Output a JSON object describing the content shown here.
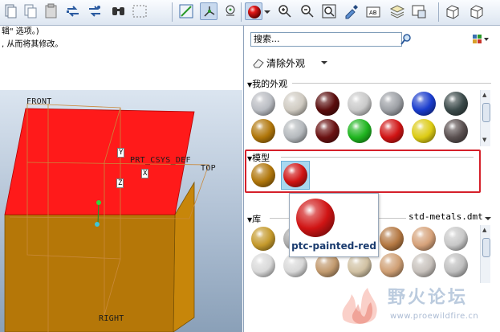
{
  "toolbar": {
    "icons": [
      "cut-icon",
      "copy-icon",
      "paste-icon",
      "regenerate-icon",
      "regenerate-manager-icon",
      "find-icon",
      "select-box-icon",
      "datum-display-icon",
      "csys-display-icon",
      "spin-center-icon",
      "appearance-gallery-icon",
      "dropdown-arrow-icon",
      "zoom-in-icon",
      "zoom-out-icon",
      "refit-icon",
      "repaint-icon",
      "annotation-icon",
      "layers-icon",
      "view-manager-icon",
      "saved-view-icon",
      "orient-icon"
    ]
  },
  "message": {
    "line1": "辑\" 选项。)",
    "line2": ", 从而将其修改。"
  },
  "viewport": {
    "label_front": "FRONT",
    "label_csys": "PRT_CSYS_DEF",
    "label_top": "TOP",
    "label_right": "RIGHT",
    "axis_y": "Y",
    "axis_x": "X",
    "axis_z": "Z",
    "colors": {
      "top_face": "#ff1a1a",
      "side_face": "#c7860a",
      "front_face": "#b57708"
    }
  },
  "panel": {
    "search_placeholder": "搜索...",
    "clear_appearance": "清除外观",
    "my_appearances": "我的外观",
    "model": "模型",
    "library": "库",
    "library_file": "std-metals.dmt",
    "tooltip_name": "ptc-painted-red",
    "my_appearance_spheres": [
      "#b9bcc2",
      "#cfcac1",
      "#5a0d0d",
      "#c9c9c9",
      "#9da0a5",
      "#1a3ccc",
      "#3b4a4a",
      "#b0760a",
      "#b5b9bd",
      "#6a1212",
      "#1fb51f",
      "#d01414",
      "#dccb14",
      "#5a5050"
    ],
    "model_spheres": [
      "#b0760a",
      "#d01414"
    ],
    "library_spheres": [
      "#c59a2c",
      "#a8a8a8",
      "#8e8e8e",
      "#b89a6a",
      "#b47842",
      "#d6a27a",
      "#c8c8c8",
      "#d9d9d9",
      "#d8d8d8",
      "#c29a6e",
      "#d1c1a3",
      "#cf9f74",
      "#c7c1bc",
      "#bfbfbf"
    ]
  },
  "watermark": {
    "text_cn": "野火论坛",
    "url": "www.proewildfire.cn"
  }
}
